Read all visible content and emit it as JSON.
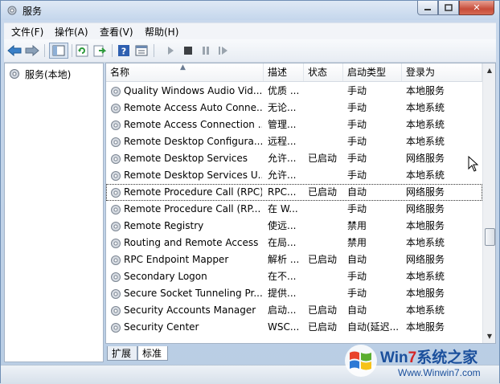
{
  "window": {
    "title": "服务"
  },
  "menu": [
    "文件(F)",
    "操作(A)",
    "查看(V)",
    "帮助(H)"
  ],
  "toolbar": {
    "icons": [
      "back-icon",
      "forward-icon",
      "show-hide-tree-icon",
      "refresh-icon",
      "export-icon",
      "help-icon",
      "properties-icon",
      "start-icon",
      "stop-icon",
      "pause-icon",
      "restart-icon"
    ]
  },
  "tree": {
    "root_label": "服务(本地)"
  },
  "columns": {
    "name": "名称",
    "desc": "描述",
    "status": "状态",
    "startup": "启动类型",
    "logon": "登录为"
  },
  "services": [
    {
      "name": "Quality Windows Audio Vid...",
      "desc": "优质 ...",
      "status": "",
      "startup": "手动",
      "logon": "本地服务"
    },
    {
      "name": "Remote Access Auto Conne...",
      "desc": "无论...",
      "status": "",
      "startup": "手动",
      "logon": "本地系统"
    },
    {
      "name": "Remote Access Connection ...",
      "desc": "管理...",
      "status": "",
      "startup": "手动",
      "logon": "本地系统"
    },
    {
      "name": "Remote Desktop Configura...",
      "desc": "远程...",
      "status": "",
      "startup": "手动",
      "logon": "本地系统"
    },
    {
      "name": "Remote Desktop Services",
      "desc": "允许...",
      "status": "已启动",
      "startup": "手动",
      "logon": "网络服务"
    },
    {
      "name": "Remote Desktop Services U...",
      "desc": "允许...",
      "status": "",
      "startup": "手动",
      "logon": "本地系统"
    },
    {
      "name": "Remote Procedure Call (RPC)",
      "desc": "RPC...",
      "status": "已启动",
      "startup": "自动",
      "logon": "网络服务",
      "focused": true
    },
    {
      "name": "Remote Procedure Call (RP...",
      "desc": "在 W...",
      "status": "",
      "startup": "手动",
      "logon": "网络服务"
    },
    {
      "name": "Remote Registry",
      "desc": "使远...",
      "status": "",
      "startup": "禁用",
      "logon": "本地服务"
    },
    {
      "name": "Routing and Remote Access",
      "desc": "在局...",
      "status": "",
      "startup": "禁用",
      "logon": "本地系统"
    },
    {
      "name": "RPC Endpoint Mapper",
      "desc": "解析 ...",
      "status": "已启动",
      "startup": "自动",
      "logon": "网络服务"
    },
    {
      "name": "Secondary Logon",
      "desc": "在不...",
      "status": "",
      "startup": "手动",
      "logon": "本地系统"
    },
    {
      "name": "Secure Socket Tunneling Pr...",
      "desc": "提供...",
      "status": "",
      "startup": "手动",
      "logon": "本地服务"
    },
    {
      "name": "Security Accounts Manager",
      "desc": "启动...",
      "status": "已启动",
      "startup": "自动",
      "logon": "本地系统"
    },
    {
      "name": "Security Center",
      "desc": "WSC...",
      "status": "已启动",
      "startup": "自动(延迟...",
      "logon": "本地服务"
    }
  ],
  "tabs": [
    "扩展",
    "标准"
  ],
  "watermark": {
    "brand_a": "Win",
    "brand_b": "7",
    "brand_c": "系统之家",
    "url": "Www.Winwin7.com"
  }
}
